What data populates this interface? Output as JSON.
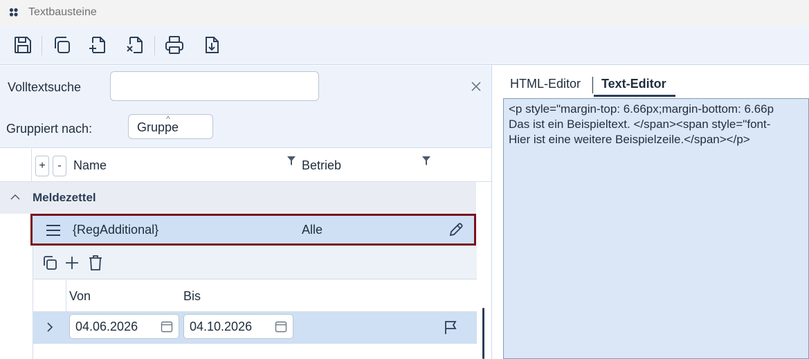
{
  "window": {
    "title": "Textbausteine"
  },
  "toolbar": {
    "buttons": [
      {
        "name": "save",
        "icon": "save-icon"
      },
      {
        "name": "copy",
        "icon": "copy-icon"
      },
      {
        "name": "new-document",
        "icon": "document-add-icon"
      },
      {
        "name": "delete-document",
        "icon": "document-delete-icon"
      },
      {
        "name": "print",
        "icon": "printer-icon"
      },
      {
        "name": "export",
        "icon": "document-download-icon"
      }
    ]
  },
  "filters": {
    "fulltext_label": "Volltextsuche",
    "fulltext_value": "",
    "group_label": "Gruppiert nach:",
    "group_value": "Gruppe"
  },
  "grid": {
    "add_label": "+",
    "remove_label": "-",
    "columns": [
      "Name",
      "Betrieb"
    ],
    "group": {
      "name": "Meldezettel"
    },
    "rows": [
      {
        "name": "{RegAdditional}",
        "betrieb": "Alle"
      }
    ]
  },
  "detail": {
    "columns": [
      "Von",
      "Bis"
    ],
    "rows": [
      {
        "von": "04.06.2026",
        "bis": "04.10.2026"
      }
    ]
  },
  "editor": {
    "tabs": [
      "HTML-Editor",
      "Text-Editor"
    ],
    "active_tab": "Text-Editor",
    "lines": [
      "<p style=\"margin-top: 6.66px;margin-bottom: 6.66p",
      "Das ist ein Beispieltext. </span><span style=\"font-",
      "Hier ist eine weitere Beispielzeile.</span></p>"
    ]
  },
  "colors": {
    "accent": "#2c3e57",
    "selected_row": "#cfe0f4",
    "selection_border": "#7a0f1e",
    "toolbar_bg": "#eef3fb"
  }
}
